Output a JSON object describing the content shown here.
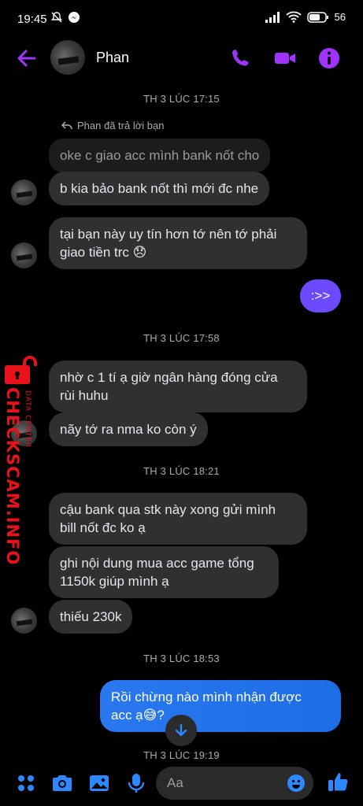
{
  "status_bar": {
    "time": "19:45",
    "battery": "56"
  },
  "header": {
    "contact_name": "Phan"
  },
  "chat": {
    "timestamps": [
      "TH 3 LÚC 17:15",
      "TH 3 LÚC 17:58",
      "TH 3 LÚC 18:21",
      "TH 3 LÚC 18:53",
      "TH 3 LÚC 19:19"
    ],
    "reply_note": "Phan đã trả lời bạn",
    "messages": [
      {
        "text": "oke c giao acc mình bank nốt cho"
      },
      {
        "text": "b kia bảo bank nốt thì mới đc nhe"
      },
      {
        "text": "tại bạn này uy tín hơn tớ nên tớ phải\ngiao tiền trc 😞"
      },
      {
        "text": ":>>"
      },
      {
        "text": "nhờ c 1 tí ạ giờ ngân hàng đóng cửa\nrùi huhu"
      },
      {
        "text": "nãy tớ ra nma ko còn ý"
      },
      {
        "text": "cậu bank qua stk này xong gửi mình\nbill nốt đc ko ạ"
      },
      {
        "text": "ghi nội dung mua acc game tổng\n1150k giúp mình ạ"
      },
      {
        "text": "thiếu 230k"
      },
      {
        "text": "Rồi chừng nào mình nhận được\nacc ạ😅?"
      }
    ]
  },
  "watermark": {
    "brand": "CHECKSCAM.INFO",
    "sub": "DATA CENTER"
  },
  "composer": {
    "placeholder": "Aa"
  },
  "colors": {
    "accent": "#a033ff",
    "outgoing_bubble": "#6d4aff",
    "outgoing_bubble_blue": "#1f70e8",
    "incoming_bubble": "#303030",
    "watermark": "#e8121b",
    "composer_icon": "#2d88ff"
  },
  "icons": [
    "back-arrow-icon",
    "phone-icon",
    "video-icon",
    "info-icon",
    "reply-icon",
    "arrow-down-icon",
    "apps-icon",
    "camera-icon",
    "gallery-icon",
    "microphone-icon",
    "emoji-icon",
    "thumbs-up-icon",
    "lock-icon"
  ]
}
